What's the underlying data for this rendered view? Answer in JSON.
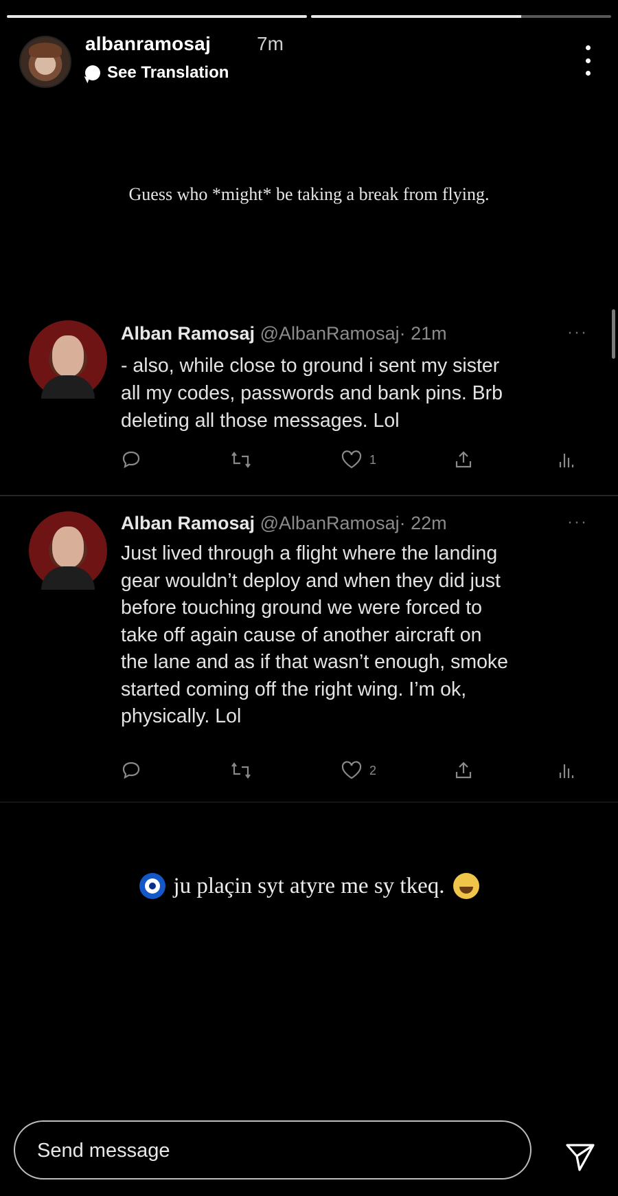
{
  "story": {
    "progress_segments": [
      {
        "fill": 1.0
      },
      {
        "fill": 0.7
      }
    ],
    "header": {
      "username": "albanramosaj",
      "time_ago": "7m",
      "see_translation": "See Translation"
    },
    "caption_top": "Guess who *might* be taking a break from flying.",
    "caption_bottom": "ju plaçin syt atyre me sy tkeq."
  },
  "tweets": [
    {
      "name": "Alban Ramosaj",
      "handle": "@AlbanRamosaj",
      "time": "· 21m",
      "dots": "···",
      "lines": [
        "- also, while close to ground i sent my sister",
        "all my codes, passwords and bank pins. Brb",
        "deleting all those messages. Lol"
      ],
      "likes": "1"
    },
    {
      "name": "Alban Ramosaj",
      "handle": "@AlbanRamosaj",
      "time": "· 22m",
      "dots": "···",
      "lines": [
        "Just lived through a flight where the landing",
        "gear wouldn’t deploy and when they did just",
        "before touching ground we were forced to",
        "take off again cause of another aircraft on",
        "the lane and as if that wasn’t enough, smoke",
        "started coming off the right wing. I’m ok,",
        "physically. Lol"
      ],
      "likes": "2"
    }
  ],
  "message_bar": {
    "placeholder": "Send message"
  },
  "icons": {
    "more": "more-vertical-icon",
    "translate": "speech-bubble-icon",
    "reply": "reply-icon",
    "retweet": "retweet-icon",
    "like": "heart-icon",
    "share": "share-icon",
    "analytics": "analytics-icon",
    "nazar": "nazar-eye-icon",
    "laugh": "laughing-emoji-icon",
    "send": "send-icon"
  },
  "colors": {
    "background": "#000000",
    "handle_gray": "#8b8b8b",
    "tweet_text": "#e3e3e3"
  }
}
